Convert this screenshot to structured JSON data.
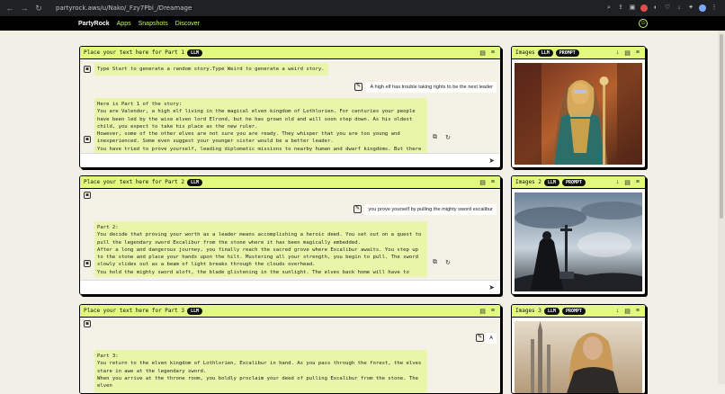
{
  "browser": {
    "url": "partyrock.aws/u/Nako/_Fzy7Pbi_/Dreamage",
    "nav": [
      "←",
      "→",
      "↻"
    ],
    "toolbar_icons": [
      "zoom-icon",
      "share-icon",
      "screenshot-icon",
      "record-icon",
      "extension-icon",
      "bookmark-icon",
      "download-icon",
      "extensions-icon",
      "profile-icon",
      "menu-icon"
    ]
  },
  "app": {
    "brand": "PartyRock",
    "links": [
      "Apps",
      "Snapshots",
      "Discover"
    ],
    "accent": "#e1f97f"
  },
  "parts": [
    {
      "title": "Place your text here for Part 1",
      "badge": "LLM",
      "intro": "Type Start to generate a random story.Type Weird to generate a weird story.",
      "user_msg": "A high elf has trouble taking rights to be the next leader",
      "reply": "Here is Part 1 of the story:\nYou are Valendor, a high elf living in the magical elven kingdom of Lothlorien. For centuries your people have been led by the wise elven lord Elrond, but he has grown old and will soon step down. As his oldest child, you expect to take his place as the new ruler.\nHowever, some of the other elves are not sure you are ready. They whisper that you are too young and inexperienced. Some even suggest your younger sister would be a better leader.\nYou have tried to prove yourself, leading diplomatic missions to nearby human and dwarf kingdoms. But there are"
    },
    {
      "title": "Place your text here for Part 2",
      "badge": "LLM",
      "intro": "",
      "user_msg": "you prove yourself by pulling the mighty sword excalibur",
      "reply": "Part 2:\nYou decide that proving your worth as a leader means accomplishing a heroic deed. You set out on a quest to pull the legendary sword Excalibur from the stone where it has been magically embedded.\nAfter a long and dangerous journey, you finally reach the sacred grove where Excalibur awaits. You step up to the stone and place your hands upon the hilt. Mustering all your strength, you begin to pull. The sword slowly slides out as a beam of light breaks through the clouds overhead.\nYou hold the mighty sword aloft, the blade glistening in the sunlight. The elves back home will have to acknowledge your right to lead now. Excalibur is yours."
    },
    {
      "title": "Place your text here for Part 3",
      "badge": "LLM",
      "intro": "",
      "user_msg": "A",
      "reply": "Part 3:\nYou return to the elven kingdom of Lothlorien, Excalibur in hand. As you pass through the forest, the elves stare in awe at the legendary sword.\nWhen you arrive at the throne room, you boldly proclaim your deed of pulling Excalibur from the stone. The elven"
    }
  ],
  "images": [
    {
      "title": "Images",
      "badges": [
        "LLM",
        "PROMPT"
      ]
    },
    {
      "title": "Images 2",
      "badges": [
        "LLM",
        "PROMPT"
      ]
    },
    {
      "title": "Images 3",
      "badges": [
        "LLM",
        "PROMPT"
      ]
    }
  ]
}
